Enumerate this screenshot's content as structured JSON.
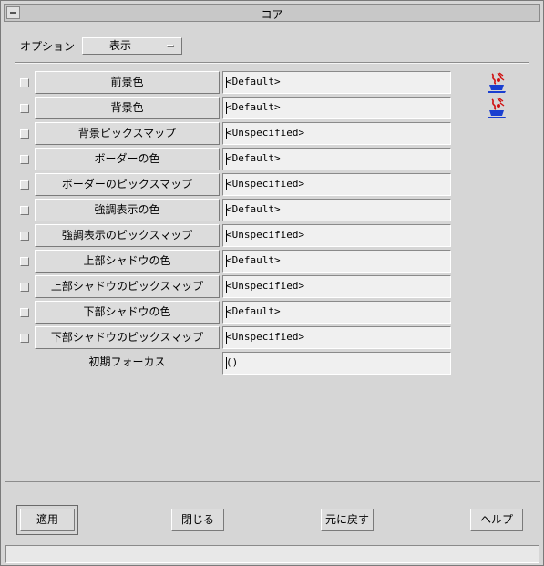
{
  "window": {
    "title": "コア"
  },
  "option": {
    "label": "オプション",
    "value": "表示"
  },
  "properties": [
    {
      "label": "前景色",
      "value": "<Default>",
      "has_checkbox": true,
      "has_edit_icon": true
    },
    {
      "label": "背景色",
      "value": "<Default>",
      "has_checkbox": true,
      "has_edit_icon": true
    },
    {
      "label": "背景ピックスマップ",
      "value": "<Unspecified>",
      "has_checkbox": true,
      "has_edit_icon": false
    },
    {
      "label": "ボーダーの色",
      "value": "<Default>",
      "has_checkbox": true,
      "has_edit_icon": false
    },
    {
      "label": "ボーダーのピックスマップ",
      "value": "<Unspecified>",
      "has_checkbox": true,
      "has_edit_icon": false
    },
    {
      "label": "強調表示の色",
      "value": "<Default>",
      "has_checkbox": true,
      "has_edit_icon": false
    },
    {
      "label": "強調表示のピックスマップ",
      "value": "<Unspecified>",
      "has_checkbox": true,
      "has_edit_icon": false
    },
    {
      "label": "上部シャドウの色",
      "value": "<Default>",
      "has_checkbox": true,
      "has_edit_icon": false
    },
    {
      "label": "上部シャドウのピックスマップ",
      "value": "<Unspecified>",
      "has_checkbox": true,
      "has_edit_icon": false
    },
    {
      "label": "下部シャドウの色",
      "value": "<Default>",
      "has_checkbox": true,
      "has_edit_icon": false
    },
    {
      "label": "下部シャドウのピックスマップ",
      "value": "<Unspecified>",
      "has_checkbox": true,
      "has_edit_icon": false
    },
    {
      "label": "初期フォーカス",
      "value": "()",
      "has_checkbox": false,
      "has_edit_icon": false
    }
  ],
  "icons": {
    "edit": "color-editor-icon",
    "window_menu": "window-menu-icon"
  },
  "buttons": {
    "apply": "適用",
    "close": "閉じる",
    "reset": "元に戻す",
    "help": "ヘルプ"
  },
  "colors": {
    "background": "#d6d6d6",
    "icon_red": "#d01010",
    "icon_blue": "#1a3fd0"
  }
}
